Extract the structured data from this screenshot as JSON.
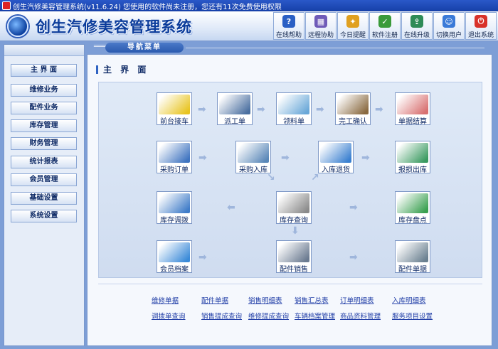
{
  "window": {
    "title": "创生汽修美容管理系统(v11.6.24)   您使用的软件尚未注册，您还有11次免费使用权限"
  },
  "logo": {
    "text": "创生汽修美容管理系统"
  },
  "toolbar": [
    {
      "label": "在线帮助",
      "icon": "help-icon",
      "color": "#2a5fc4",
      "glyph": "?"
    },
    {
      "label": "远程协助",
      "icon": "remote-assist-icon",
      "color": "#6f5bb8",
      "glyph": "▦"
    },
    {
      "label": "今日提醒",
      "icon": "reminder-icon",
      "color": "#e0a020",
      "glyph": "✦"
    },
    {
      "label": "软件注册",
      "icon": "register-icon",
      "color": "#3a9a3a",
      "glyph": "✓"
    },
    {
      "label": "在线升级",
      "icon": "upgrade-icon",
      "color": "#2e8b57",
      "glyph": "⇪"
    },
    {
      "label": "切换用户",
      "icon": "switch-user-icon",
      "color": "#3a7ad8",
      "glyph": "☺"
    },
    {
      "label": "退出系统",
      "icon": "exit-icon",
      "color": "#d8322a",
      "glyph": "⏻"
    }
  ],
  "nav": {
    "banner": "导航菜单",
    "items": [
      "主 界 面",
      "维修业务",
      "配件业务",
      "库存管理",
      "财务管理",
      "统计报表",
      "会员管理",
      "基础设置",
      "系统设置"
    ]
  },
  "main": {
    "title": "主 界 面",
    "tiles": [
      {
        "label": "前台接车",
        "icon": "car-reception-icon",
        "color": "#e8c420"
      },
      {
        "label": "派工单",
        "icon": "dispatch-icon",
        "color": "#4a6fa0"
      },
      {
        "label": "领料单",
        "icon": "material-requisition-icon",
        "color": "#6aa8d8"
      },
      {
        "label": "完工确认",
        "icon": "completion-icon",
        "color": "#8a6a40"
      },
      {
        "label": "单据结算",
        "icon": "settlement-icon",
        "color": "#d87070"
      },
      {
        "label": "采购订单",
        "icon": "purchase-order-icon",
        "color": "#3f74c0"
      },
      {
        "label": "采购入库",
        "icon": "purchase-inbound-icon",
        "color": "#5a88b8"
      },
      {
        "label": "入库退货",
        "icon": "inbound-return-icon",
        "color": "#3a80d0"
      },
      {
        "label": "报损出库",
        "icon": "loss-outbound-icon",
        "color": "#3a9a60"
      },
      {
        "label": "库存调拨",
        "icon": "stock-transfer-icon",
        "color": "#3f7cc8"
      },
      {
        "label": "库存查询",
        "icon": "stock-query-icon",
        "color": "#8a8a8a"
      },
      {
        "label": "库存盘点",
        "icon": "stock-count-icon",
        "color": "#3aa050"
      },
      {
        "label": "会员档案",
        "icon": "member-file-icon",
        "color": "#3a8ad8"
      },
      {
        "label": "配件销售",
        "icon": "parts-sales-icon",
        "color": "#6a7a90"
      },
      {
        "label": "配件单据",
        "icon": "parts-document-icon",
        "color": "#6a8090"
      }
    ],
    "links": [
      "维修单据",
      "配件单据",
      "销售明细表",
      "销售汇总表",
      "订单明细表",
      "入库明细表",
      "调拨单查询",
      "销售提成查询",
      "维修提成查询",
      "车辆档案管理",
      "商品资料管理",
      "服务项目设置"
    ]
  }
}
